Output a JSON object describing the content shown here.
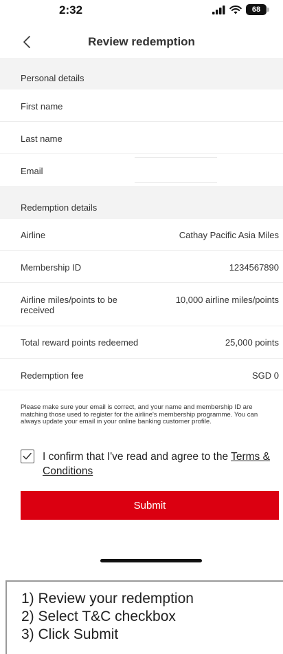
{
  "status_bar": {
    "time": "2:32",
    "battery": "68"
  },
  "header": {
    "title": "Review redemption"
  },
  "personal": {
    "section_title": "Personal details",
    "first_name_label": "First name",
    "last_name_label": "Last name",
    "email_label": "Email"
  },
  "redemption": {
    "section_title": "Redemption details",
    "rows": [
      {
        "label": "Airline",
        "value": "Cathay Pacific Asia Miles"
      },
      {
        "label": "Membership ID",
        "value": "1234567890"
      },
      {
        "label": "Airline miles/points to be received",
        "value": "10,000 airline miles/points"
      },
      {
        "label": "Total reward points redeemed",
        "value": "25,000 points"
      },
      {
        "label": "Redemption fee",
        "value": "SGD 0"
      }
    ]
  },
  "disclaimer": "Please make sure your email is correct, and your name and membership ID are matching those used to register for the airline's membership programme. You can always update your email in your online banking customer profile.",
  "consent": {
    "checked": true,
    "text": "I confirm that I've read and agree to the ",
    "link": "Terms & Conditions"
  },
  "submit_label": "Submit",
  "instructions": [
    "1) Review your redemption",
    "2) Select T&C checkbox",
    "3) Click Submit"
  ],
  "colors": {
    "accent": "#db0011",
    "section_bg": "#f3f3f3"
  }
}
